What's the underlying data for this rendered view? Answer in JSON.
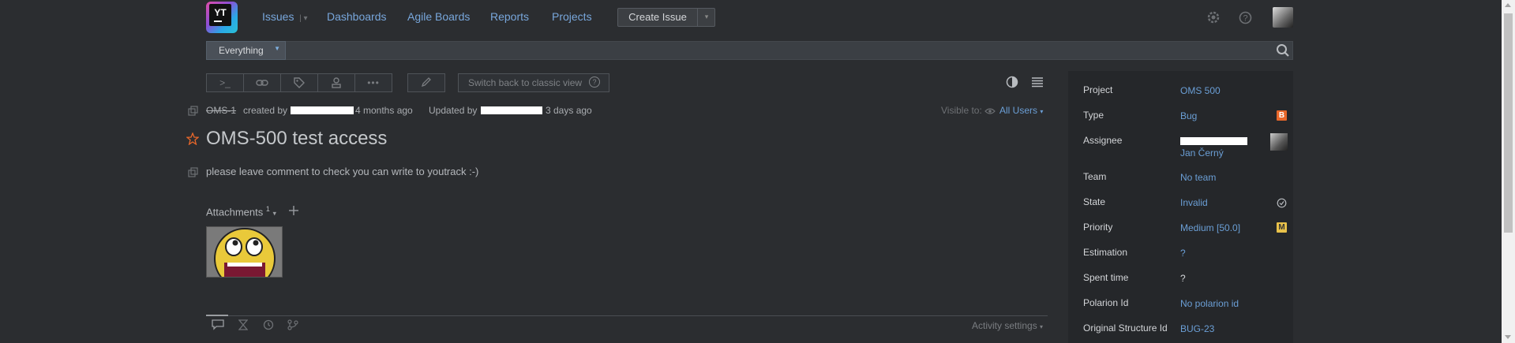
{
  "header": {
    "logo_text": "YT",
    "nav": {
      "issues": "Issues",
      "dashboards": "Dashboards",
      "agile_boards": "Agile Boards",
      "reports": "Reports",
      "projects": "Projects"
    },
    "create_issue": "Create Issue"
  },
  "search": {
    "scope": "Everything",
    "value": ""
  },
  "toolbar": {
    "classic_view": "Switch back to classic view",
    "cmd_label": ">_",
    "more_label": "•••"
  },
  "issue": {
    "id": "OMS-1",
    "created_by": "created by",
    "created_ago": "4 months ago",
    "updated_by": "Updated by",
    "updated_ago": "3 days ago",
    "visible_to_label": "Visible to:",
    "visible_to_value": "All Users",
    "title": "OMS-500 test access",
    "description": "please leave comment to check you can write to youtrack :-)",
    "attachments_label": "Attachments",
    "attachments_count": "1"
  },
  "activity": {
    "settings": "Activity settings"
  },
  "fields": [
    {
      "key": "Project",
      "value": "OMS 500"
    },
    {
      "key": "Type",
      "value": "Bug",
      "badge": "B",
      "badge_color": "#e8672a"
    },
    {
      "key": "Assignee",
      "value": "Jan Černý"
    },
    {
      "key": "Team",
      "value": "No team"
    },
    {
      "key": "State",
      "value": "Invalid"
    },
    {
      "key": "Priority",
      "value": "Medium [50.0]",
      "badge": "M",
      "badge_color": "#e8c14a"
    },
    {
      "key": "Estimation",
      "value": "?"
    },
    {
      "key": "Spent time",
      "value": "?"
    },
    {
      "key": "Polarion Id",
      "value": "No polarion id"
    },
    {
      "key": "Original Structure Id",
      "value": "BUG-23"
    }
  ],
  "colors": {
    "background": "#2b2d30",
    "accent": "#6b9fd6",
    "panel": "#25272a"
  }
}
